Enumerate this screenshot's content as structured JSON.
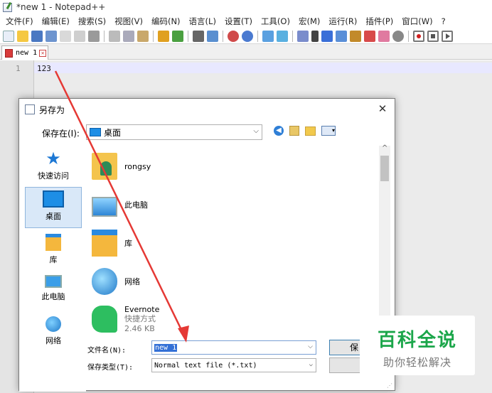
{
  "app": {
    "title": "*new 1 - Notepad++"
  },
  "menu": [
    "文件(F)",
    "编辑(E)",
    "搜索(S)",
    "视图(V)",
    "编码(N)",
    "语言(L)",
    "设置(T)",
    "工具(O)",
    "宏(M)",
    "运行(R)",
    "插件(P)",
    "窗口(W)",
    "?"
  ],
  "tab": {
    "label": "new 1"
  },
  "editor": {
    "line_number": "1",
    "line_text": "123"
  },
  "dialog": {
    "title": "另存为",
    "save_in_label": "保存在(I):",
    "save_in_value": "桌面",
    "places": [
      "快速访问",
      "桌面",
      "库",
      "此电脑",
      "网络"
    ],
    "files": [
      {
        "name": "rongsy",
        "sub1": "",
        "sub2": ""
      },
      {
        "name": "此电脑",
        "sub1": "",
        "sub2": ""
      },
      {
        "name": "库",
        "sub1": "",
        "sub2": ""
      },
      {
        "name": "网络",
        "sub1": "",
        "sub2": ""
      },
      {
        "name": "Evernote",
        "sub1": "快捷方式",
        "sub2": "2.46 KB"
      }
    ],
    "filename_label": "文件名(N):",
    "filename_value": "new 1",
    "filetype_label": "保存类型(T):",
    "filetype_value": "Normal text file (*.txt)",
    "save_button": "保"
  },
  "watermark": {
    "main": "百科全说",
    "sub": "助你轻松解决"
  },
  "colors": {
    "accent": "#1d8ee6",
    "arrow": "#e53935",
    "watermark_green": "#1ba64a"
  }
}
